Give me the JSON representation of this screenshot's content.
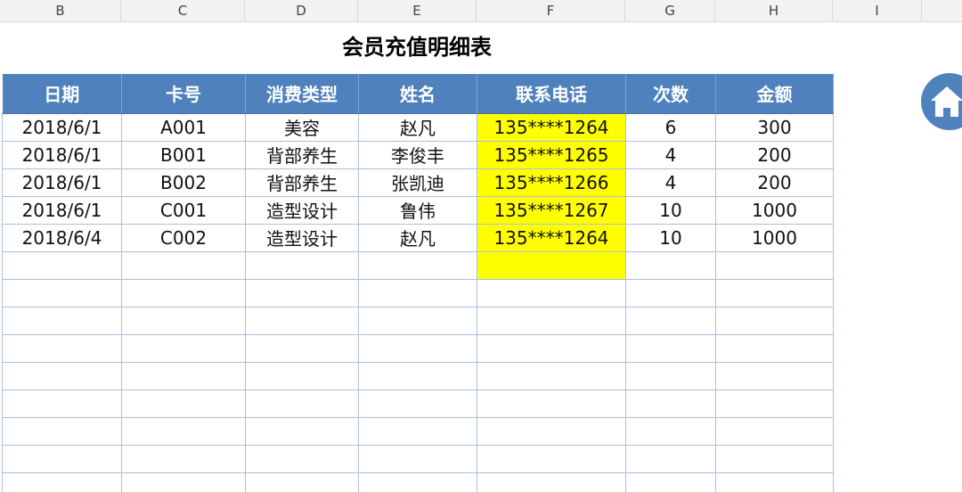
{
  "column_headers": [
    "B",
    "C",
    "D",
    "E",
    "F",
    "G",
    "H",
    "I"
  ],
  "title": "会员充值明细表",
  "table": {
    "headers": [
      "日期",
      "卡号",
      "消费类型",
      "姓名",
      "联系电话",
      "次数",
      "金额"
    ],
    "rows": [
      [
        "2018/6/1",
        "A001",
        "美容",
        "赵凡",
        "135****1264",
        "6",
        "300"
      ],
      [
        "2018/6/1",
        "B001",
        "背部养生",
        "李俊丰",
        "135****1265",
        "4",
        "200"
      ],
      [
        "2018/6/1",
        "B002",
        "背部养生",
        "张凯迪",
        "135****1266",
        "4",
        "200"
      ],
      [
        "2018/6/1",
        "C001",
        "造型设计",
        "鲁伟",
        "135****1267",
        "10",
        "1000"
      ],
      [
        "2018/6/4",
        "C002",
        "造型设计",
        "赵凡",
        "135****1264",
        "10",
        "1000"
      ]
    ],
    "highlight_column": "联系电话",
    "highlight_color": "#ffff00",
    "header_color": "#4f81bd"
  },
  "home_button": {
    "icon": "home-icon",
    "color": "#4f81bd"
  }
}
